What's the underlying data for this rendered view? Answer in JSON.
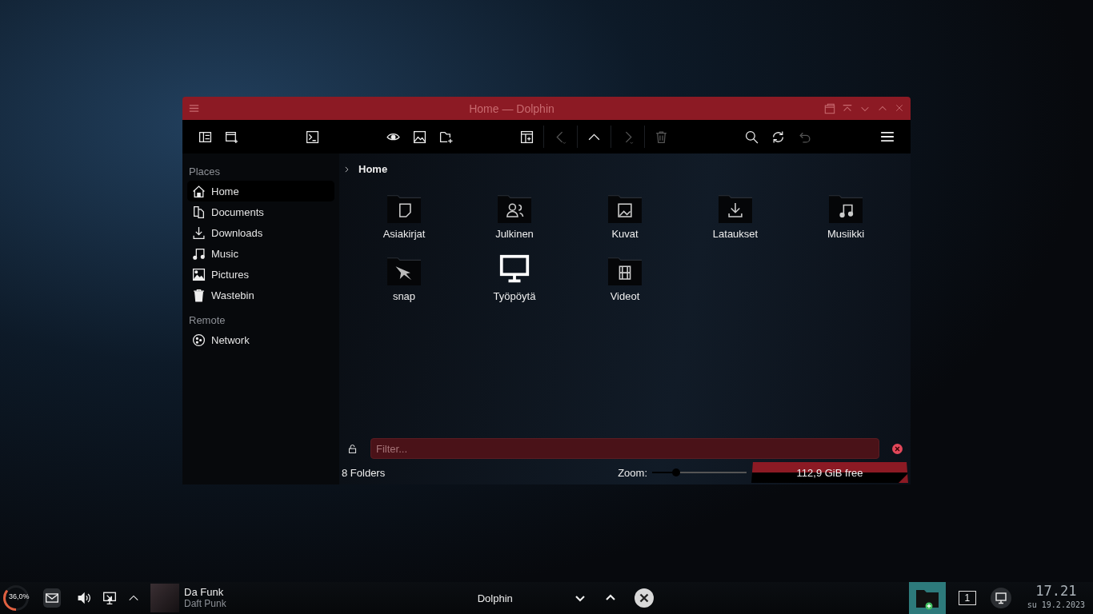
{
  "window": {
    "title": "Home — Dolphin"
  },
  "sidebar": {
    "sections": [
      {
        "heading": "Places",
        "items": [
          {
            "label": "Home",
            "kind": "home",
            "selected": true
          },
          {
            "label": "Documents",
            "kind": "documents",
            "selected": false
          },
          {
            "label": "Downloads",
            "kind": "downloads",
            "selected": false
          },
          {
            "label": "Music",
            "kind": "music",
            "selected": false
          },
          {
            "label": "Pictures",
            "kind": "pictures",
            "selected": false
          },
          {
            "label": "Wastebin",
            "kind": "trash",
            "selected": false
          }
        ]
      },
      {
        "heading": "Remote",
        "items": [
          {
            "label": "Network",
            "kind": "network",
            "selected": false
          }
        ]
      }
    ]
  },
  "breadcrumb": {
    "current": "Home"
  },
  "folders": [
    {
      "name": "Asiakirjat",
      "kind": "document"
    },
    {
      "name": "Julkinen",
      "kind": "public"
    },
    {
      "name": "Kuvat",
      "kind": "pictures"
    },
    {
      "name": "Lataukset",
      "kind": "downloads"
    },
    {
      "name": "Musiikki",
      "kind": "music"
    },
    {
      "name": "snap",
      "kind": "snap"
    },
    {
      "name": "Työpöytä",
      "kind": "desktop"
    },
    {
      "name": "Videot",
      "kind": "videos"
    }
  ],
  "filter": {
    "placeholder": "Filter..."
  },
  "status_bar": {
    "folder_count": "8 Folders",
    "zoom_label": "Zoom:",
    "zoom": {
      "level": 0.25
    },
    "free_space": "112,9 GiB free"
  },
  "taskbar": {
    "battery": {
      "text": "36,0%",
      "level": 0.36
    },
    "media": {
      "title": "Da Funk",
      "artist": "Daft Punk"
    },
    "task": {
      "label": "Dolphin"
    },
    "pager": "1",
    "clock": {
      "time": "17.21",
      "date": "su 19.2.2023"
    }
  }
}
